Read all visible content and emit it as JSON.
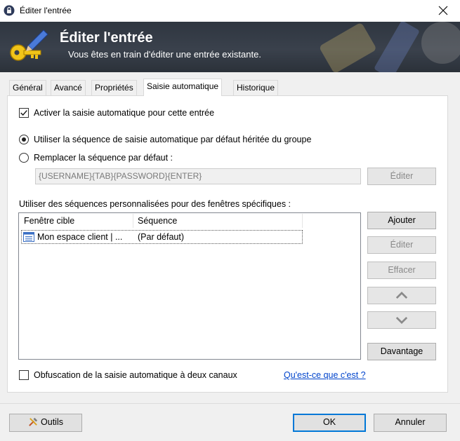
{
  "window": {
    "title": "Éditer l'entrée"
  },
  "banner": {
    "title": "Éditer l'entrée",
    "subtitle": "Vous êtes en train d'éditer une entrée existante."
  },
  "tabs": [
    {
      "label": "Général"
    },
    {
      "label": "Avancé"
    },
    {
      "label": "Propriétés"
    },
    {
      "label": "Saisie automatique",
      "active": true
    },
    {
      "label": "Historique"
    }
  ],
  "autotype": {
    "enable_label": "Activer la saisie automatique pour cette entrée",
    "enable_checked": true,
    "inherit_label": "Utiliser la séquence de saisie automatique par défaut héritée du groupe",
    "override_label": "Remplacer la séquence par défaut :",
    "selected_option": "inherit",
    "sequence_value": "{USERNAME}{TAB}{PASSWORD}{ENTER}",
    "edit_label": "Éditer",
    "custom_label": "Utiliser des séquences personnalisées pour des fenêtres spécifiques :",
    "columns": [
      "Fenêtre cible",
      "Séquence"
    ],
    "rows": [
      {
        "target": "Mon espace client | ...",
        "sequence": "(Par défaut)"
      }
    ],
    "side_buttons": {
      "add": "Ajouter",
      "edit": "Éditer",
      "delete": "Effacer",
      "more": "Davantage"
    },
    "obfuscation_label": "Obfuscation de la saisie automatique à deux canaux",
    "obfuscation_checked": false,
    "help_link": "Qu'est-ce que c'est ?"
  },
  "footer": {
    "tools": "Outils",
    "ok": "OK",
    "cancel": "Annuler"
  },
  "colors": {
    "banner_bg": "#3a414c",
    "accent": "#0078d7",
    "link": "#0044cc"
  }
}
